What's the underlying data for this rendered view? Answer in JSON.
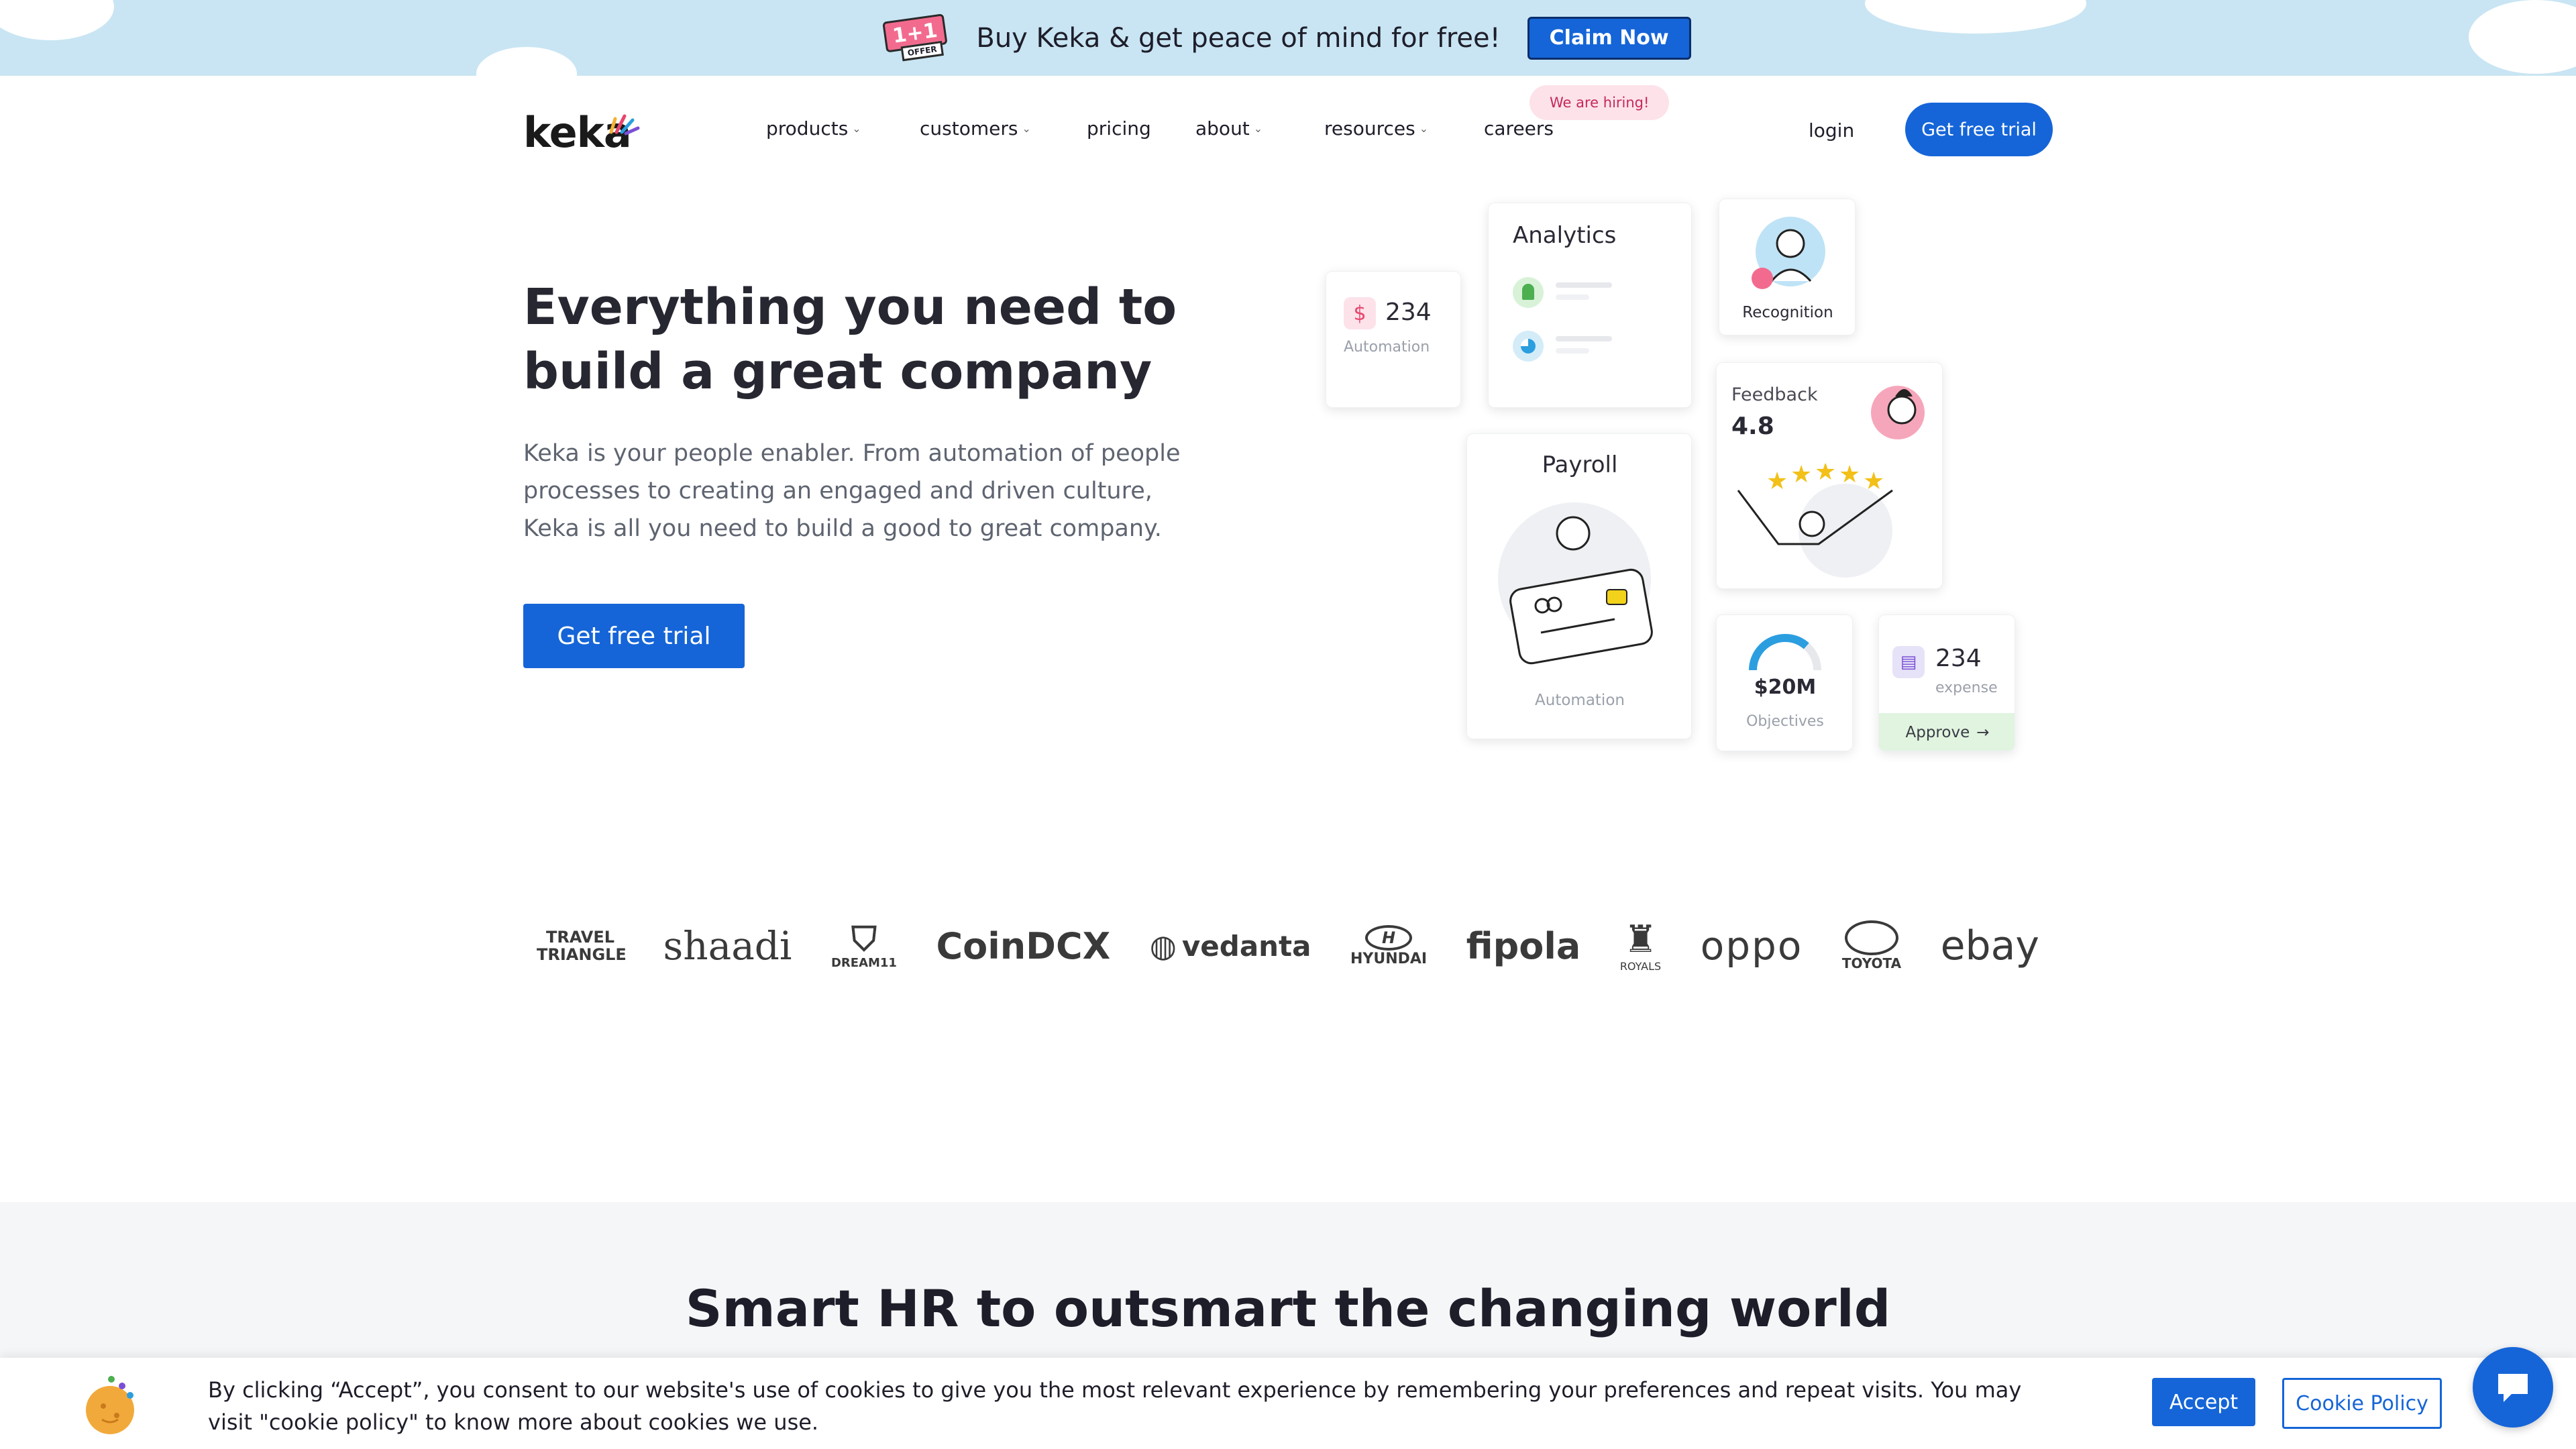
{
  "promo": {
    "offer_tag": "1+1",
    "offer_sub": "OFFER",
    "text": "Buy Keka & get peace of mind for free!",
    "claim_label": "Claim Now"
  },
  "nav": {
    "logo": "keka",
    "items": [
      {
        "label": "products",
        "dropdown": true
      },
      {
        "label": "customers",
        "dropdown": true
      },
      {
        "label": "pricing",
        "dropdown": false
      },
      {
        "label": "about",
        "dropdown": true
      },
      {
        "label": "resources",
        "dropdown": true
      },
      {
        "label": "careers",
        "dropdown": false
      }
    ],
    "hiring_badge": "We are hiring!",
    "login": "login",
    "trial_label": "Get free trial"
  },
  "hero": {
    "title_line1": "Everything you need to",
    "title_line2": "build a great company",
    "subtitle": "Keka is your people enabler. From automation of people processes to creating an engaged and driven culture, Keka is all you need to build a good to great company.",
    "cta": "Get free trial"
  },
  "cards": {
    "automation": {
      "value": "234",
      "label": "Automation"
    },
    "analytics": {
      "title": "Analytics"
    },
    "recognition": {
      "label": "Recognition"
    },
    "feedback": {
      "title": "Feedback",
      "rating": "4.8"
    },
    "payroll": {
      "title": "Payroll",
      "label": "Automation"
    },
    "objectives": {
      "value": "$20M",
      "label": "Objectives"
    },
    "expense": {
      "value": "234",
      "label": "expense",
      "approve": "Approve"
    }
  },
  "logos": [
    "TRAVEL TRIANGLE",
    "shaadi",
    "DREAM11",
    "CoinDCX",
    "vedanta",
    "HYUNDAI",
    "fipola",
    "ROYALS",
    "oppo",
    "TOYOTA",
    "ebay"
  ],
  "section2": {
    "title": "Smart HR to outsmart the changing world"
  },
  "cookie": {
    "text": "By clicking “Accept”, you consent to our website's use of cookies to give you the most relevant experience by remembering your preferences and repeat visits. You may visit \"cookie policy\" to know more about cookies we use.",
    "accept": "Accept",
    "policy": "Cookie Policy"
  },
  "colors": {
    "primary": "#1565d8",
    "promo_bg": "#c9e5f3",
    "hiring_bg": "#fde2ea",
    "section_bg": "#f5f6f8"
  }
}
